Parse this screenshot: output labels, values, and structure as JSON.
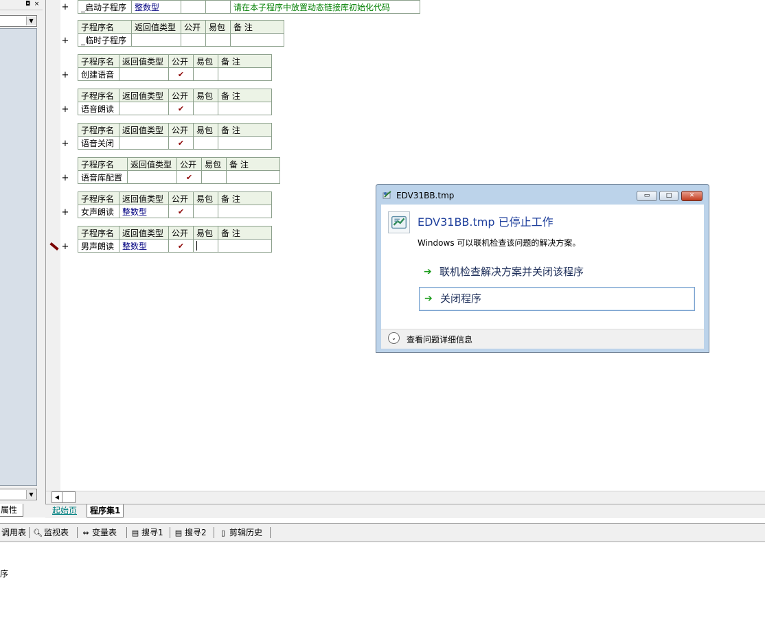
{
  "left_panel": {
    "pin_icon": "pin-icon",
    "close_icon": "×",
    "combo_drop": "▼",
    "properties_tab": "属性"
  },
  "editor": {
    "plus_glyph": "+",
    "header": {
      "name": "子程序名",
      "return_type": "返回值类型",
      "public": "公开",
      "easy_pack": "易包",
      "note": "备 注"
    },
    "check_glyph": "✔",
    "subroutines": [
      {
        "name": "_启动子程序",
        "return_type": "整数型",
        "public": "",
        "easy_pack": "",
        "note": "请在本子程序中放置动态链接库初始化代码",
        "show_header": false
      },
      {
        "name": "_临时子程序",
        "return_type": "",
        "public": "",
        "easy_pack": "",
        "note": "",
        "show_header": true
      },
      {
        "name": "创建语音",
        "return_type": "",
        "public": "✔",
        "easy_pack": "",
        "note": "",
        "show_header": true
      },
      {
        "name": "语音朗读",
        "return_type": "",
        "public": "✔",
        "easy_pack": "",
        "note": "",
        "show_header": true
      },
      {
        "name": "语音关闭",
        "return_type": "",
        "public": "✔",
        "easy_pack": "",
        "note": "",
        "show_header": true
      },
      {
        "name": "语音库配置",
        "return_type": "",
        "public": "✔",
        "easy_pack": "",
        "note": "",
        "show_header": true
      },
      {
        "name": "女声朗读",
        "return_type": "整数型",
        "public": "✔",
        "easy_pack": "",
        "note": "",
        "show_header": true
      },
      {
        "name": "男声朗读",
        "return_type": "整数型",
        "public": "✔",
        "easy_pack": "",
        "note": "",
        "show_header": true,
        "breakpoint": true
      }
    ]
  },
  "tabs": {
    "start_page": "起始页",
    "program_set": "程序集1"
  },
  "bottom_toolbar": {
    "items": [
      "调用表",
      "监视表",
      "变量表",
      "搜寻1",
      "搜寻2",
      "剪辑历史"
    ]
  },
  "output": {
    "text": "序"
  },
  "dialog": {
    "title": "EDV31BB.tmp",
    "heading": "EDV31BB.tmp 已停止工作",
    "subtext": "Windows 可以联机检查该问题的解决方案。",
    "action_check_online": "联机检查解决方案并关闭该程序",
    "action_close": "关闭程序",
    "details": "查看问题详细信息",
    "min_glyph": "▭",
    "max_glyph": "□",
    "close_glyph": "✕",
    "arrow_glyph": "➔",
    "chevron_glyph": "⌄"
  }
}
